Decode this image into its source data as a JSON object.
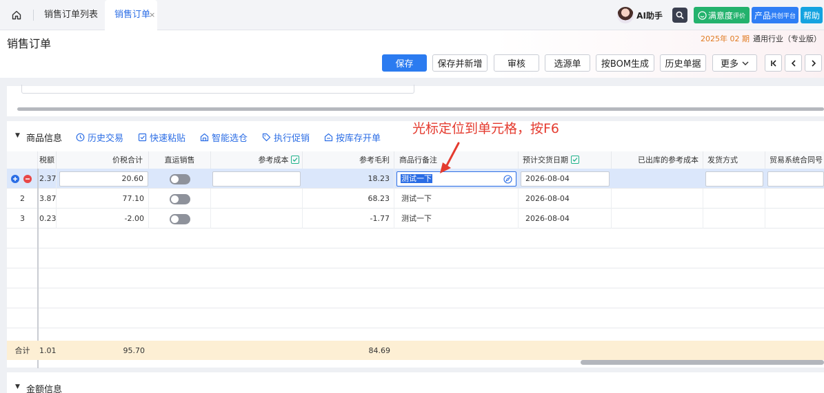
{
  "tabs": {
    "list_label": "销售订单列表",
    "active_label": "销售订单",
    "close_glyph": "×"
  },
  "topright": {
    "ai_label": "AI助手",
    "satisfaction_label": "满意度",
    "satisfaction_suffix": "评价",
    "product_label": "产品",
    "product_suffix": "共创平台",
    "help_label": "帮助"
  },
  "header": {
    "title": "销售订单",
    "period": "2025年 02 期",
    "separator": "|",
    "industry": "通用行业（专业版）"
  },
  "toolbar": {
    "save": "保存",
    "save_new": "保存并新增",
    "audit": "审核",
    "source": "选源单",
    "bom": "按BOM生成",
    "history": "历史单据",
    "more": "更多",
    "more_caret": "⌄"
  },
  "section": {
    "title": "商品信息",
    "links": [
      "历史交易",
      "快速粘贴",
      "智能选仓",
      "执行促销",
      "按库存开单"
    ]
  },
  "annotation": "光标定位到单元格，按F6",
  "columns": {
    "tax": "税额",
    "total": "价税合计",
    "direct": "直运销售",
    "ref_cost": "参考成本",
    "ref_margin": "参考毛利",
    "remark": "商品行备注",
    "date": "预计交货日期",
    "out_cost": "已出库的参考成本",
    "ship": "发货方式",
    "contract": "贸易系统合同号"
  },
  "rows": [
    {
      "num": "",
      "tax": "2.37",
      "total": "20.60",
      "margin": "18.23",
      "remark": "测试一下",
      "date": "2026-08-04"
    },
    {
      "num": "2",
      "tax": "3.87",
      "total": "77.10",
      "margin": "68.23",
      "remark": "测试一下",
      "date": "2026-08-04"
    },
    {
      "num": "3",
      "tax": "0.23",
      "total": "-2.00",
      "margin": "-1.77",
      "remark": "测试一下",
      "date": "2026-08-04"
    }
  ],
  "summary": {
    "label": "合计",
    "tax": "1.01",
    "total": "95.70",
    "margin": "84.69"
  },
  "next_section": "金额信息",
  "colors": {
    "primary": "#2b7bf0",
    "annotation": "#e43b2f",
    "period": "#e07a20",
    "summary_bg": "#fdefd4"
  }
}
